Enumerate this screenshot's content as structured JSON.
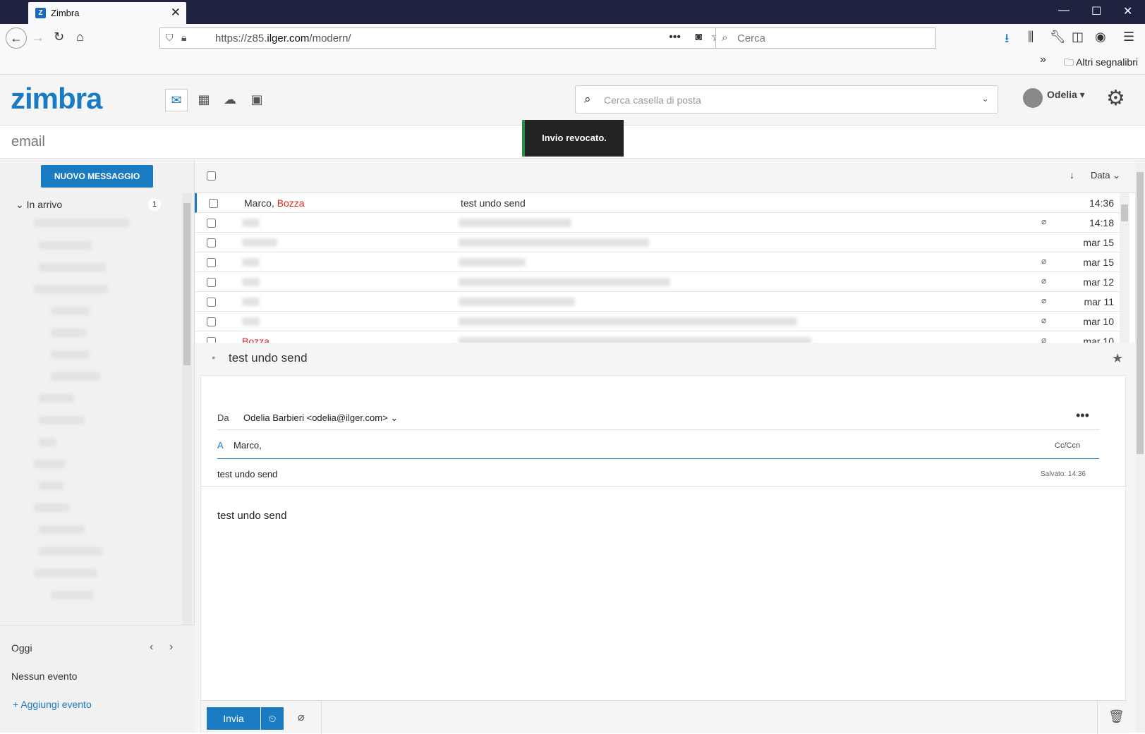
{
  "browser": {
    "tab_title": "Zimbra",
    "url_prefix": "https://z85.",
    "url_domain": "ilger.com",
    "url_path": "/modern/",
    "search_placeholder": "Cerca",
    "bookmarks_label": "Altri segnalibri"
  },
  "app": {
    "logo": "zimbra",
    "search_placeholder": "Cerca casella di posta",
    "user_name": "Odelia",
    "page_title": "email",
    "toast": "Invio revocato."
  },
  "sidebar": {
    "new_message": "NUOVO MESSAGGIO",
    "inbox_label": "In arrivo",
    "inbox_count": "1",
    "calendar_today": "Oggi",
    "no_events": "Nessun evento",
    "add_event": "Aggiungi evento"
  },
  "list": {
    "sort_label": "Data",
    "rows": [
      {
        "from": "Marco,",
        "draft": "Bozza",
        "subject": "test undo send",
        "date": "14:36",
        "attach": false
      },
      {
        "from": "",
        "subject": "",
        "date": "14:18",
        "attach": true
      },
      {
        "from": "",
        "subject": "",
        "date": "mar 15",
        "attach": false
      },
      {
        "from": "",
        "subject": "",
        "date": "mar 15",
        "attach": true
      },
      {
        "from": "",
        "subject": "",
        "date": "mar 12",
        "attach": true
      },
      {
        "from": "",
        "subject": "",
        "date": "mar 11",
        "attach": true
      },
      {
        "from": "",
        "subject": "",
        "date": "mar 10",
        "attach": true
      },
      {
        "from": "",
        "draft": "Bozza",
        "subject": "",
        "date": "mar 10",
        "attach": true
      }
    ]
  },
  "reader": {
    "title": "test undo send",
    "from_label": "Da",
    "from_value": "Odelia Barbieri <odelia@ilger.com>",
    "to_label": "A",
    "to_value": "Marco,",
    "cc_label": "Cc/Ccn",
    "subject": "test undo send",
    "saved": "Salvato: 14:36",
    "body": "test undo send",
    "send_label": "Invia"
  }
}
